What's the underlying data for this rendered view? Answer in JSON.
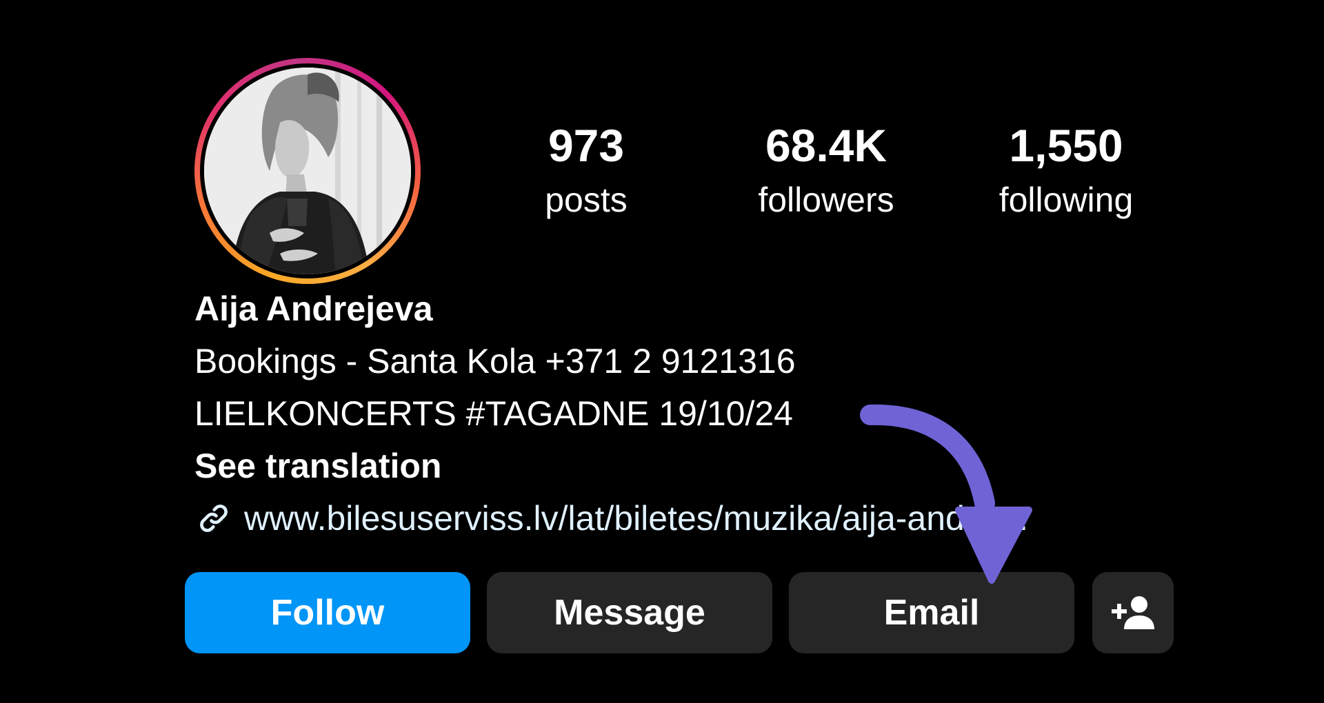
{
  "profile": {
    "avatar_icon": "profile-photo",
    "stats": [
      {
        "value": "973",
        "label": "posts"
      },
      {
        "value": "68.4K",
        "label": "followers"
      },
      {
        "value": "1,550",
        "label": "following"
      }
    ],
    "name": "Aija Andrejeva",
    "bio_lines": [
      "Bookings - Santa Kola +371 2 9121316",
      "LIELKONCERTS #TAGADNE 19/10/24"
    ],
    "see_translation": "See translation",
    "link_icon": "link-icon",
    "link": "www.bilesuserviss.lv/lat/biletes/muzika/aija-andre…"
  },
  "actions": {
    "follow_label": "Follow",
    "message_label": "Message",
    "email_label": "Email",
    "add_icon": "add-user-icon"
  },
  "colors": {
    "follow": "#0095f6",
    "button": "#262626",
    "annotation_arrow": "#6f63d6",
    "background": "#000000"
  }
}
